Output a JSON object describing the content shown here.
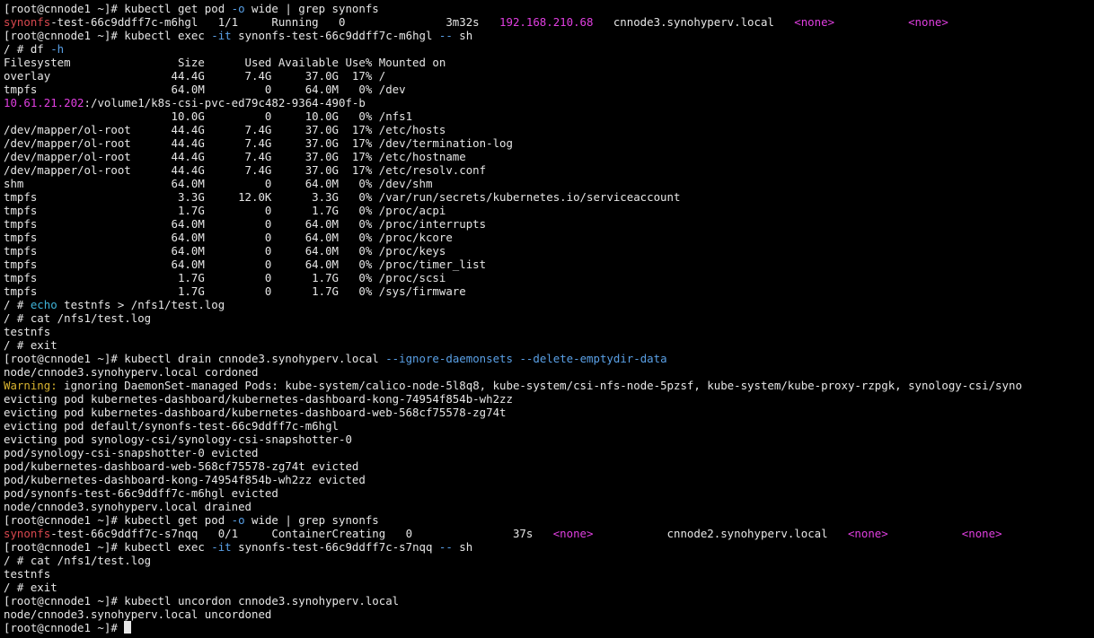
{
  "terminal": {
    "colors": {
      "background": "#000000",
      "default": "#e6e6e6",
      "red": "#d9484f",
      "magenta": "#e03fe0",
      "cyan": "#3fb4d9",
      "blue": "#5aa0e6",
      "yellow": "#d9b430"
    },
    "lines": [
      [
        {
          "t": "[root@cnnode1 ~]# kubectl get pod "
        },
        {
          "t": "-o",
          "c": "blue"
        },
        {
          "t": " wide | grep synonfs"
        }
      ],
      [
        {
          "t": "synonfs",
          "c": "red"
        },
        {
          "t": "-test-66c9ddff7c-m6hgl   1/1     Running   0               3m32s   "
        },
        {
          "t": "192.168.210.68",
          "c": "magenta"
        },
        {
          "t": "   cnnode3.synohyperv.local   "
        },
        {
          "t": "<none>",
          "c": "magenta"
        },
        {
          "t": "           "
        },
        {
          "t": "<none>",
          "c": "magenta"
        }
      ],
      [
        {
          "t": "[root@cnnode1 ~]# kubectl exec "
        },
        {
          "t": "-it",
          "c": "blue"
        },
        {
          "t": " synonfs-test-66c9ddff7c-m6hgl "
        },
        {
          "t": "--",
          "c": "blue"
        },
        {
          "t": " sh"
        }
      ],
      [
        {
          "t": "/ # df "
        },
        {
          "t": "-h",
          "c": "blue"
        }
      ],
      [
        {
          "t": "Filesystem                Size      Used Available Use% Mounted on"
        }
      ],
      [
        {
          "t": "overlay                  44.4G      7.4G     37.0G  17% /"
        }
      ],
      [
        {
          "t": "tmpfs                    64.0M         0     64.0M   0% /dev"
        }
      ],
      [
        {
          "t": "10.61.21.202",
          "c": "magenta"
        },
        {
          "t": ":/volume1/k8s-csi-pvc-ed79c482-9364-490f-b"
        }
      ],
      [
        {
          "t": "                         10.0G         0     10.0G   0% /nfs1"
        }
      ],
      [
        {
          "t": "/dev/mapper/ol-root      44.4G      7.4G     37.0G  17% /etc/hosts"
        }
      ],
      [
        {
          "t": "/dev/mapper/ol-root      44.4G      7.4G     37.0G  17% /dev/termination-log"
        }
      ],
      [
        {
          "t": "/dev/mapper/ol-root      44.4G      7.4G     37.0G  17% /etc/hostname"
        }
      ],
      [
        {
          "t": "/dev/mapper/ol-root      44.4G      7.4G     37.0G  17% /etc/resolv.conf"
        }
      ],
      [
        {
          "t": "shm                      64.0M         0     64.0M   0% /dev/shm"
        }
      ],
      [
        {
          "t": "tmpfs                     3.3G     12.0K      3.3G   0% /var/run/secrets/kubernetes.io/serviceaccount"
        }
      ],
      [
        {
          "t": "tmpfs                     1.7G         0      1.7G   0% /proc/acpi"
        }
      ],
      [
        {
          "t": "tmpfs                    64.0M         0     64.0M   0% /proc/interrupts"
        }
      ],
      [
        {
          "t": "tmpfs                    64.0M         0     64.0M   0% /proc/kcore"
        }
      ],
      [
        {
          "t": "tmpfs                    64.0M         0     64.0M   0% /proc/keys"
        }
      ],
      [
        {
          "t": "tmpfs                    64.0M         0     64.0M   0% /proc/timer_list"
        }
      ],
      [
        {
          "t": "tmpfs                     1.7G         0      1.7G   0% /proc/scsi"
        }
      ],
      [
        {
          "t": "tmpfs                     1.7G         0      1.7G   0% /sys/firmware"
        }
      ],
      [
        {
          "t": "/ # "
        },
        {
          "t": "echo",
          "c": "cyan"
        },
        {
          "t": " testnfs > /nfs1/test.log"
        }
      ],
      [
        {
          "t": "/ # cat /nfs1/test.log"
        }
      ],
      [
        {
          "t": "testnfs"
        }
      ],
      [
        {
          "t": "/ # exit"
        }
      ],
      [
        {
          "t": "[root@cnnode1 ~]# kubectl drain cnnode3.synohyperv.local "
        },
        {
          "t": "--ignore-daemonsets",
          "c": "blue"
        },
        {
          "t": " "
        },
        {
          "t": "--delete-emptydir-data",
          "c": "blue"
        }
      ],
      [
        {
          "t": "node/cnnode3.synohyperv.local cordoned"
        }
      ],
      [
        {
          "t": "Warning:",
          "c": "yellow"
        },
        {
          "t": " ignoring DaemonSet-managed Pods: kube-system/calico-node-5l8q8, kube-system/csi-nfs-node-5pzsf, kube-system/kube-proxy-rzpgk, synology-csi/syno"
        }
      ],
      [
        {
          "t": "evicting pod kubernetes-dashboard/kubernetes-dashboard-kong-74954f854b-wh2zz"
        }
      ],
      [
        {
          "t": "evicting pod kubernetes-dashboard/kubernetes-dashboard-web-568cf75578-zg74t"
        }
      ],
      [
        {
          "t": "evicting pod default/synonfs-test-66c9ddff7c-m6hgl"
        }
      ],
      [
        {
          "t": "evicting pod synology-csi/synology-csi-snapshotter-0"
        }
      ],
      [
        {
          "t": "pod/synology-csi-snapshotter-0 evicted"
        }
      ],
      [
        {
          "t": "pod/kubernetes-dashboard-web-568cf75578-zg74t evicted"
        }
      ],
      [
        {
          "t": "pod/kubernetes-dashboard-kong-74954f854b-wh2zz evicted"
        }
      ],
      [
        {
          "t": "pod/synonfs-test-66c9ddff7c-m6hgl evicted"
        }
      ],
      [
        {
          "t": "node/cnnode3.synohyperv.local drained"
        }
      ],
      [
        {
          "t": "[root@cnnode1 ~]# kubectl get pod "
        },
        {
          "t": "-o",
          "c": "blue"
        },
        {
          "t": " wide | grep synonfs"
        }
      ],
      [
        {
          "t": "synonfs",
          "c": "red"
        },
        {
          "t": "-test-66c9ddff7c-s7nqq   0/1     ContainerCreating   0               37s   "
        },
        {
          "t": "<none>",
          "c": "magenta"
        },
        {
          "t": "           cnnode2.synohyperv.local   "
        },
        {
          "t": "<none>",
          "c": "magenta"
        },
        {
          "t": "           "
        },
        {
          "t": "<none>",
          "c": "magenta"
        }
      ],
      [
        {
          "t": "[root@cnnode1 ~]# kubectl exec "
        },
        {
          "t": "-it",
          "c": "blue"
        },
        {
          "t": " synonfs-test-66c9ddff7c-s7nqq "
        },
        {
          "t": "--",
          "c": "blue"
        },
        {
          "t": " sh"
        }
      ],
      [
        {
          "t": "/ # cat /nfs1/test.log"
        }
      ],
      [
        {
          "t": "testnfs"
        }
      ],
      [
        {
          "t": "/ # exit"
        }
      ],
      [
        {
          "t": "[root@cnnode1 ~]# kubectl uncordon cnnode3.synohyperv.local"
        }
      ],
      [
        {
          "t": "node/cnnode3.synohyperv.local uncordoned"
        }
      ],
      [
        {
          "t": "[root@cnnode1 ~]# "
        }
      ]
    ],
    "cursor_icon": "block-cursor"
  }
}
